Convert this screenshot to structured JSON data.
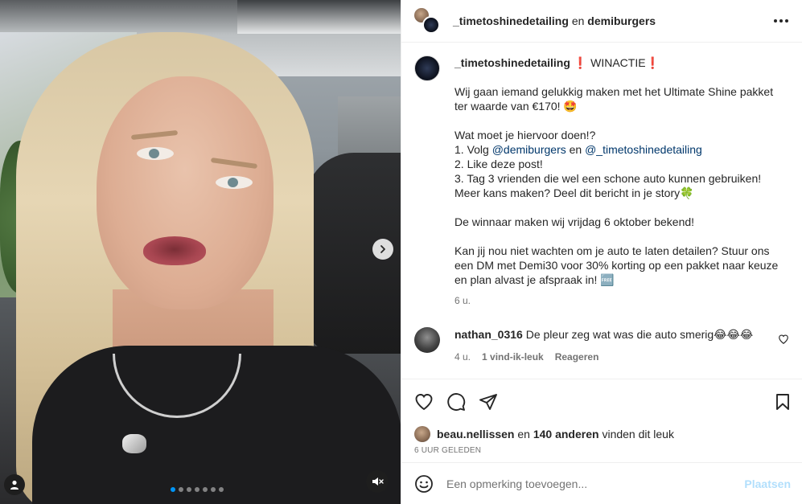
{
  "header": {
    "user1": "_timetoshinedetailing",
    "connector": "en",
    "user2": "demiburgers"
  },
  "caption": {
    "username": "_timetoshinedetailing",
    "title": "❗ WINACTIE❗",
    "line1": "Wij gaan iemand gelukkig maken met het Ultimate Shine pakket ter waarde van €170! 🤩",
    "line2": "Wat moet je hiervoor doen!?",
    "step1_prefix": "1. Volg ",
    "step1_mention1": "@demiburgers",
    "step1_middle": " en ",
    "step1_mention2": "@_timetoshinedetailing",
    "step2": "2. Like deze post!",
    "step3": "3. Tag 3 vrienden die wel een schone auto kunnen gebruiken! Meer kans maken? Deel dit bericht in je story🍀",
    "line3": "De winnaar maken wij vrijdag 6 oktober bekend!",
    "line4": "Kan jij nou niet wachten om je auto te laten detailen? Stuur ons een DM met Demi30 voor 30% korting op een pakket naar keuze en plan alvast je afspraak in! 🆓",
    "time": "6 u."
  },
  "comment": {
    "username": "nathan_0316",
    "text": "De pleur zeg wat was die auto smerig😂😂😂",
    "time": "4 u.",
    "likes": "1 vind-ik-leuk",
    "reply": "Reageren"
  },
  "likes": {
    "user": "beau.nellissen",
    "middle": "en",
    "count": "140 anderen",
    "suffix": "vinden dit leuk"
  },
  "posted": "6 UUR GELEDEN",
  "input": {
    "placeholder": "Een opmerking toevoegen...",
    "post_label": "Plaatsen"
  },
  "carousel": {
    "current": 1,
    "total": 7
  },
  "colors": {
    "accent": "#0095f6",
    "mention": "#00376b",
    "post_disabled": "#b2dffc"
  },
  "icons": [
    "more-icon",
    "heart-icon",
    "comment-icon",
    "share-icon",
    "bookmark-icon",
    "emoji-icon",
    "chevron-right-icon",
    "user-tag-icon",
    "muted-speaker-icon"
  ]
}
